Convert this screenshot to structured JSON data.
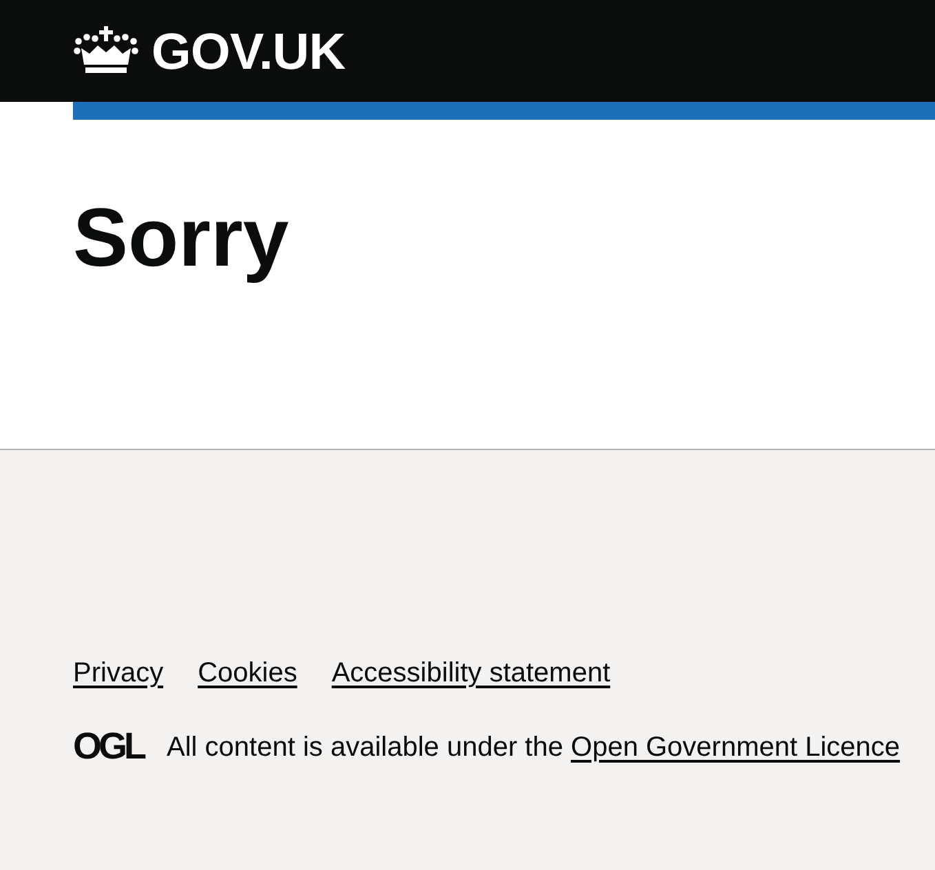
{
  "header": {
    "logo_text": "GOV.UK"
  },
  "main": {
    "heading": "Sorry"
  },
  "footer": {
    "links": [
      "Privacy",
      "Cookies",
      "Accessibility statement"
    ],
    "licence": {
      "logo_text": "OGL",
      "text": "All content is available under the",
      "link": "Open Government Licence"
    }
  }
}
